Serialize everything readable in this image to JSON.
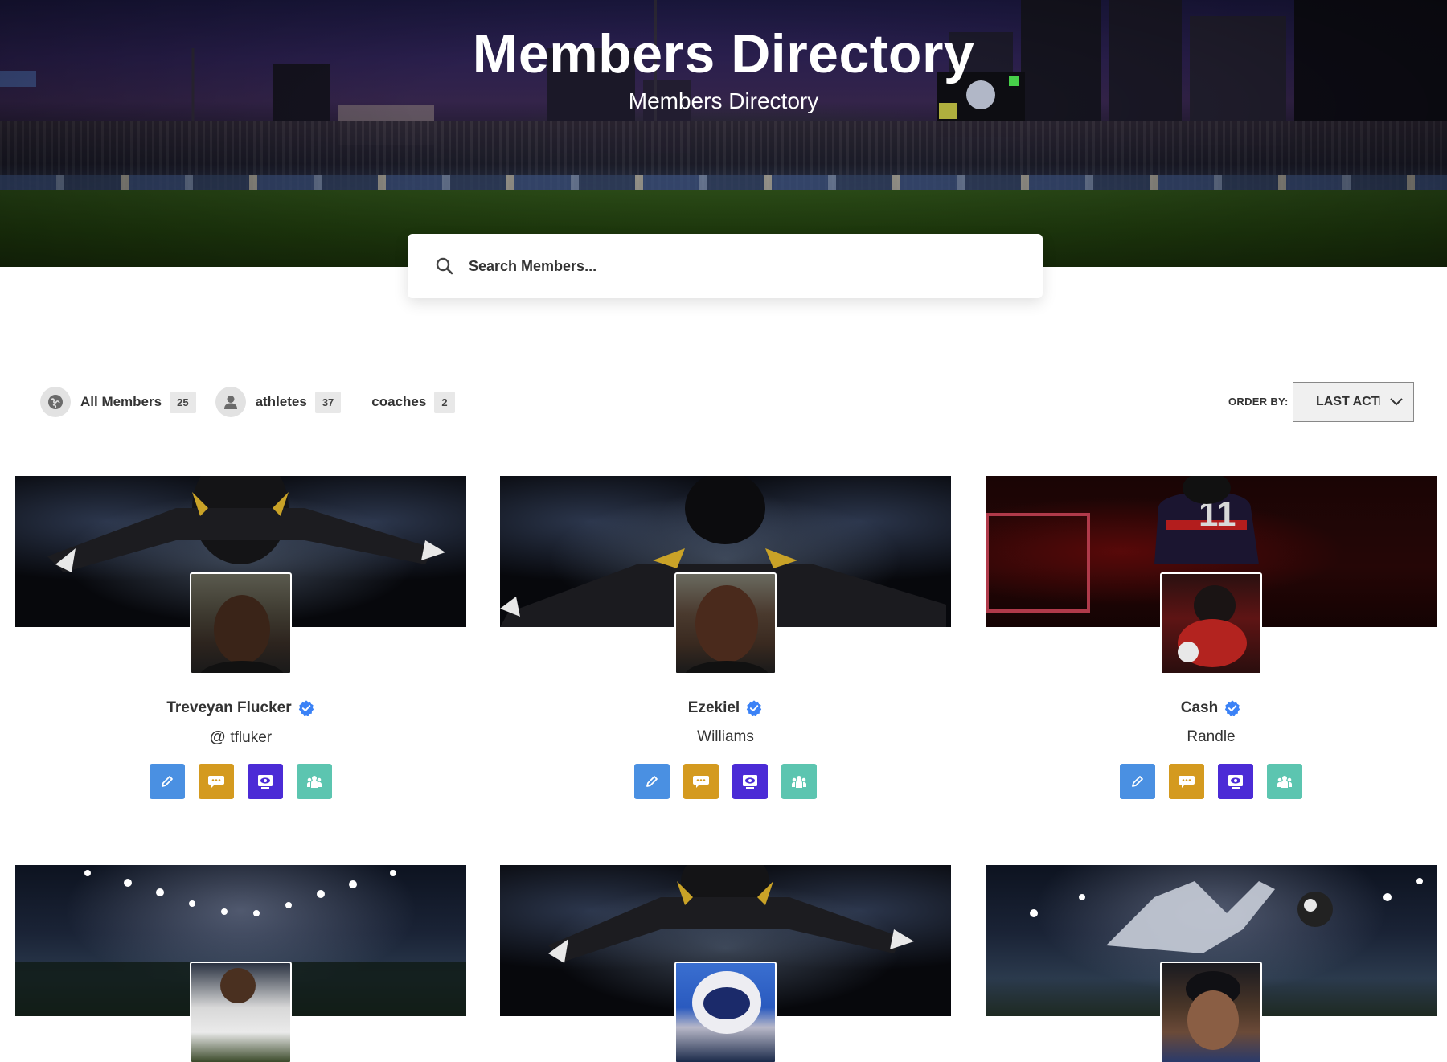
{
  "hero": {
    "title": "Members Directory",
    "subtitle": "Members Directory"
  },
  "search": {
    "placeholder": "Search Members..."
  },
  "filters": [
    {
      "label": "All Members",
      "count": "25",
      "icon": "globe-icon"
    },
    {
      "label": "athletes",
      "count": "37",
      "icon": "user-icon"
    },
    {
      "label": "coaches",
      "count": "2",
      "icon": ""
    }
  ],
  "order_by": {
    "label": "ORDER BY:",
    "selected": "LAST ACTIVE"
  },
  "members": [
    {
      "name": "Treveyan Flucker",
      "sub": "tfluker",
      "sub_is_handle": true,
      "verified": true
    },
    {
      "name": "Ezekiel",
      "sub": "Williams",
      "sub_is_handle": false,
      "verified": true
    },
    {
      "name": "Cash",
      "sub": "Randle",
      "sub_is_handle": false,
      "verified": true
    },
    {
      "name": "",
      "sub": "",
      "sub_is_handle": false,
      "verified": false
    },
    {
      "name": "",
      "sub": "",
      "sub_is_handle": false,
      "verified": false
    },
    {
      "name": "",
      "sub": "",
      "sub_is_handle": false,
      "verified": false
    }
  ],
  "actions": [
    "pencil-icon",
    "chat-bubble-icon",
    "profile-view-icon",
    "group-icon"
  ],
  "colors": {
    "edit": "#4a90e2",
    "message": "#d49a1f",
    "view": "#4b2bd6",
    "group": "#5cc5b0",
    "verified": "#3b82f6"
  }
}
